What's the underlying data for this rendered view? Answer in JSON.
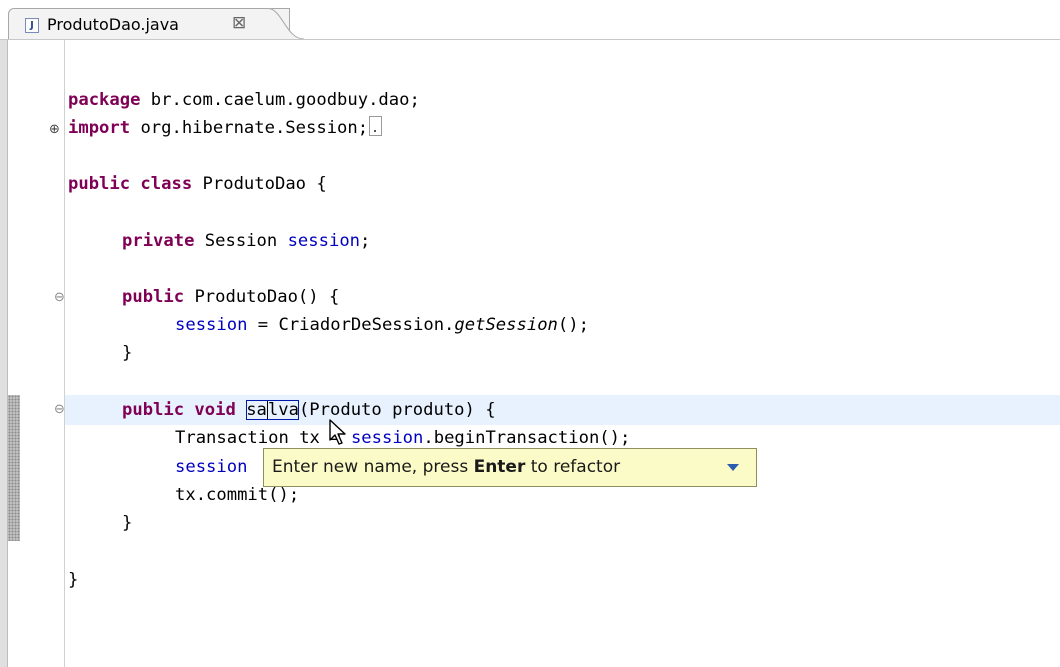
{
  "editor_tab": {
    "file_name": "ProdutoDao.java",
    "file_icon": "java-file-icon",
    "file_icon_letter": "J",
    "close_glyph": "⊠",
    "close_icon": "close-icon"
  },
  "code": {
    "package_kw": "package",
    "package_name": " br.com.caelum.goodbuy.dao;",
    "import_kw": "import",
    "import_name": " org.hibernate.Session;",
    "class_kw": "public class",
    "class_name": " ProdutoDao {",
    "field_kw": "private",
    "field_type": " Session ",
    "field_name": "session",
    "field_end": ";",
    "ctor_kw": "public",
    "ctor_sig": " ProdutoDao() {",
    "ctor_body_field": "session",
    "ctor_body_mid": " = CriadorDeSession.",
    "ctor_body_method": "getSession",
    "ctor_body_end": "();",
    "close_brace": "}",
    "method_kw": "public void",
    "method_name_a": "sa",
    "method_name_b": "l",
    "method_name_c": "va",
    "method_params": "(Produto produto) {",
    "line_tx_a": "Transact",
    "line_tx_b": "ion tx = ",
    "line_tx_field": "session",
    "line_tx_end": ".beginTransaction();",
    "line_save_field": "session",
    "line_commit": "tx.commit();",
    "class_close": "}"
  },
  "rename_tooltip": {
    "text_before": "Enter new name, press ",
    "text_bold": "Enter",
    "text_after": " to refactor",
    "menu_icon": "dropdown-arrow-icon"
  },
  "colors": {
    "keyword": "#7f0055",
    "field": "#0000c0",
    "tooltip_bg": "#fbfbc8",
    "current_line": "#e8f2fe"
  }
}
